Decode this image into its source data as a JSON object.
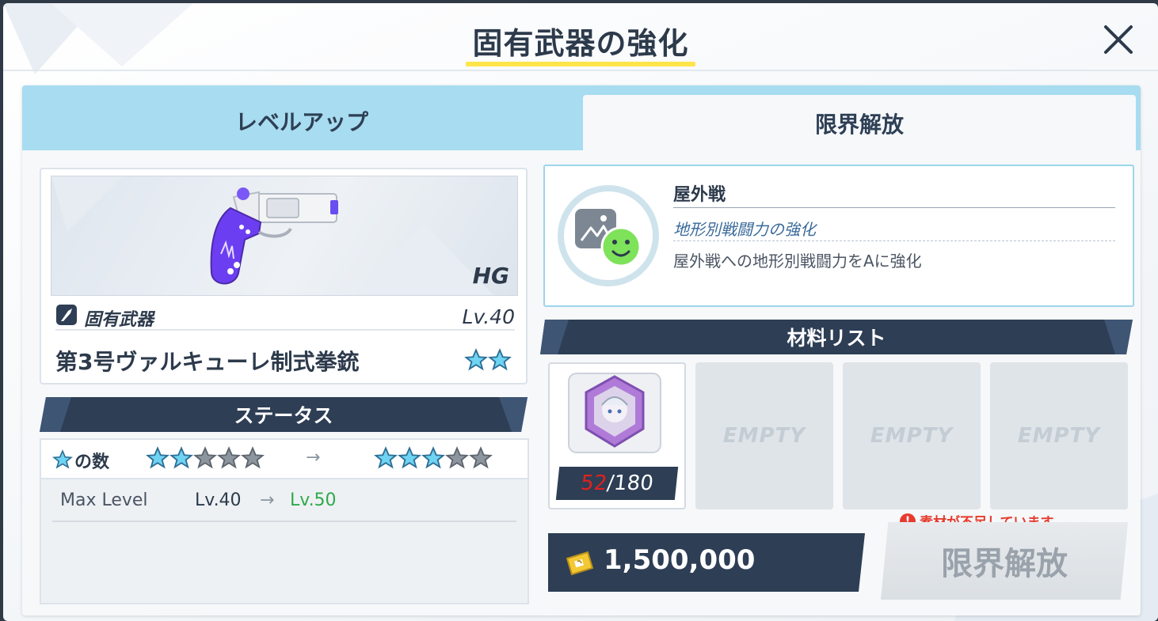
{
  "dialog": {
    "title": "固有武器の強化",
    "close_icon": "close-icon"
  },
  "tabs": [
    {
      "label": "レベルアップ",
      "active": false
    },
    {
      "label": "限界解放",
      "active": true
    }
  ],
  "weapon": {
    "class": "HG",
    "unique_label": "固有武器",
    "level": "Lv.40",
    "name": "第3号ヴァルキューレ制式拳銃",
    "stars": 2
  },
  "status": {
    "header": "ステータス",
    "star_count_label": "の数",
    "stars_current": 2,
    "stars_next": 3,
    "stars_total": 5,
    "arrow": "→",
    "max_level_label": "Max Level",
    "max_level_current": "Lv.40",
    "max_level_next": "Lv.50"
  },
  "skill": {
    "name": "屋外戦",
    "type": "地形別戦闘力の強化",
    "description": "屋外戦への地形別戦闘力をAに強化"
  },
  "materials": {
    "header": "材料リスト",
    "slot1": {
      "have": "52",
      "sep_need": "/180"
    },
    "empty_label": "EMPTY"
  },
  "cost": {
    "value": "1,500,000",
    "icon": "credit-icon"
  },
  "warning": {
    "icon": "!",
    "text": "素材が不足しています。"
  },
  "action": {
    "label": "限界解放",
    "enabled": false
  },
  "colors": {
    "accent_blue": "#a8dcf0",
    "navy": "#2d3e55",
    "title_underline": "#ffe54a",
    "warning": "#e63b2e",
    "next_value": "#2ea94a"
  }
}
